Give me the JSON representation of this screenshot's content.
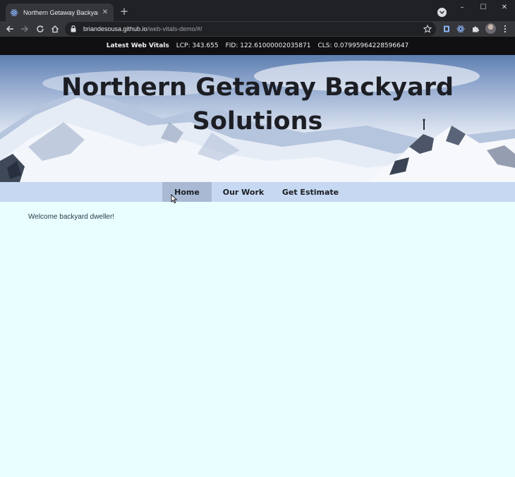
{
  "browser": {
    "tab_title": "Northern Getaway Backyard Solu",
    "url_host": "briandesousa.github.io",
    "url_path": "/web-vitals-demo/#/",
    "window_controls": {
      "minimize": "–",
      "maximize": "☐",
      "close": "✕"
    }
  },
  "vitals_bar": {
    "title": "Latest Web Vitals",
    "lcp": "LCP: 343.655",
    "fid": "FID: 122.61000002035871",
    "cls": "CLS: 0.07995964228596647"
  },
  "hero": {
    "title_line1": "Northern Getaway Backyard",
    "title_line2": "Solutions"
  },
  "nav": {
    "items": [
      {
        "label": "Home",
        "active": true
      },
      {
        "label": "Our Work",
        "active": false
      },
      {
        "label": "Get Estimate",
        "active": false
      }
    ]
  },
  "content": {
    "welcome": "Welcome backyard dweller!"
  },
  "colors": {
    "page_bg": "#e8feff",
    "vitals_bg": "#101012",
    "nav_bg": "#c7d8f2",
    "nav_active_bg": "#a9b9d4",
    "title_color": "#1c1e24"
  }
}
